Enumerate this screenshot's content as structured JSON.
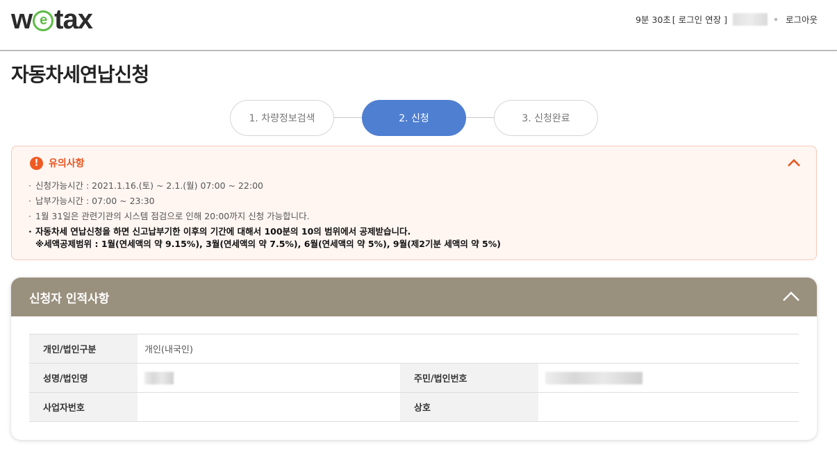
{
  "header": {
    "logo_text_left": "w",
    "logo_text_mid": "e",
    "logo_text_right": "tax",
    "session_time": "9분 30초",
    "login_extend": "[ 로그인 연장 ]",
    "logout": "로그아웃"
  },
  "page": {
    "title": "자동차세연납신청"
  },
  "stepper": {
    "steps": [
      {
        "label": "1. 차량정보검색",
        "active": false
      },
      {
        "label": "2. 신청",
        "active": true
      },
      {
        "label": "3. 신청완료",
        "active": false
      }
    ]
  },
  "notice": {
    "title": "유의사항",
    "items": [
      "신청가능시간 : 2021.1.16.(토) ~ 2.1.(월) 07:00 ~ 22:00",
      "납부가능시간 : 07:00 ~ 23:30",
      "1월 31일은 관련기관의 시스템 점검으로 인해 20:00까지 신청 가능합니다."
    ],
    "strong_item": "자동차세 연납신청을 하면 신고납부기한 이후의 기간에 대해서 100분의 10의 범위에서 공제받습니다.",
    "strong_sub": "※세액공제범위 : 1월(연세액의 약 9.15%), 3월(연세액의 약 7.5%), 6월(연세액의 약 5%), 9월(제2기분 세액의 약 5%)"
  },
  "applicant": {
    "title": "신청자 인적사항",
    "type_label": "개인/법인구분",
    "type_value": "개인(내국인)",
    "name_label": "성명/법인명",
    "id_label": "주민/법인번호",
    "bizno_label": "사업자번호",
    "company_label": "상호"
  },
  "colors": {
    "accent_blue": "#4f7fd1",
    "warning_orange": "#ef5a23",
    "panel_header": "#9a907e",
    "logo_green": "#5dbb46"
  }
}
